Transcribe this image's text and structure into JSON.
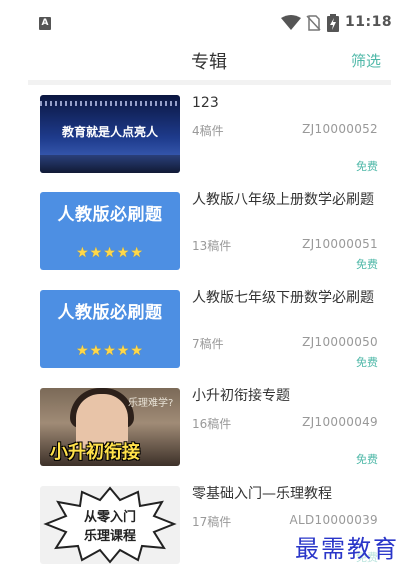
{
  "status_bar": {
    "app_icon_letter": "A",
    "time": "11:18",
    "icons": [
      "wifi-icon",
      "no-sim-icon",
      "battery-charging-icon"
    ]
  },
  "header": {
    "title": "专辑",
    "filter_label": "筛选"
  },
  "albums": [
    {
      "title": "123",
      "count": "4稿件",
      "code": "ZJ10000052",
      "price": "免费",
      "thumb_text": "教育就是人点亮人"
    },
    {
      "title": "人教版八年级上册数学必刷题",
      "count": "13稿件",
      "code": "ZJ10000051",
      "price": "免费",
      "thumb_text": "人教版必刷题",
      "thumb_stars": "★★★★★"
    },
    {
      "title": "人教版七年级下册数学必刷题",
      "count": "7稿件",
      "code": "ZJ10000050",
      "price": "免费",
      "thumb_text": "人教版必刷题",
      "thumb_stars": "★★★★★"
    },
    {
      "title": "小升初衔接专题",
      "count": "16稿件",
      "code": "ZJ10000049",
      "price": "免费",
      "thumb_text": "小升初衔接",
      "thumb_board_text": "乐理难学?"
    },
    {
      "title": "零基础入门—乐理教程",
      "count": "17稿件",
      "code": "ALD10000039",
      "price": "免费",
      "thumb_text_line1": "从零入门",
      "thumb_text_line2": "乐理课程"
    }
  ],
  "watermark": "最需教育",
  "colors": {
    "accent": "#4fb8a8",
    "thumb_blue": "#4d8fe3",
    "watermark": "#2a36c9"
  }
}
